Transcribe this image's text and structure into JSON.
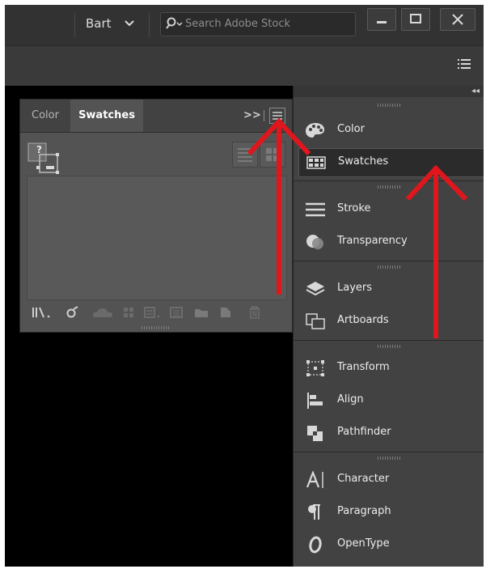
{
  "titlebar": {
    "user_name": "Bart",
    "search_placeholder": "Search Adobe Stock"
  },
  "swatches_panel": {
    "tab_color": "Color",
    "tab_swatches": "Swatches",
    "more_label": ">>",
    "none_swatch_label": "?"
  },
  "dock": {
    "collapse_label": "◂◂",
    "items": [
      {
        "label": "Color"
      },
      {
        "label": "Swatches"
      },
      {
        "label": "Stroke"
      },
      {
        "label": "Transparency"
      },
      {
        "label": "Layers"
      },
      {
        "label": "Artboards"
      },
      {
        "label": "Transform"
      },
      {
        "label": "Align"
      },
      {
        "label": "Pathfinder"
      },
      {
        "label": "Character"
      },
      {
        "label": "Paragraph"
      },
      {
        "label": "OpenType"
      }
    ]
  },
  "colors": {
    "annotation_arrow": "#e0161d",
    "panel_bg": "#535353",
    "dock_bg": "#424242"
  }
}
